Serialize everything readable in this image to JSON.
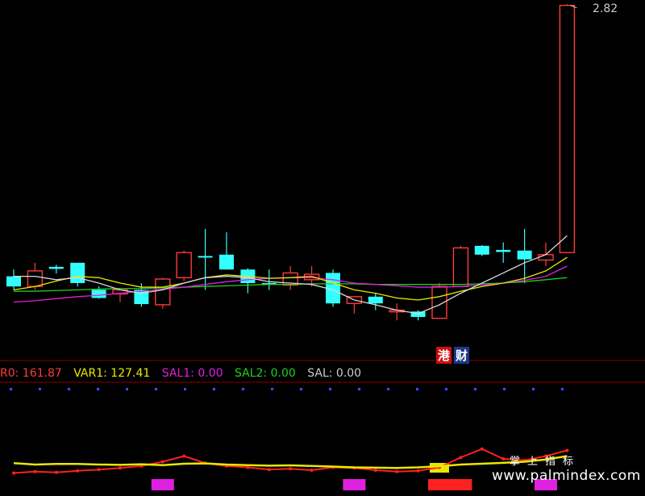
{
  "chart_data": {
    "type": "candlestick",
    "price_label": "2.82",
    "colors": {
      "up": "#ff3b3b",
      "down": "#33ffff",
      "ma1": "#d8d8d8",
      "ma2": "#e8e800",
      "ma3": "#e020e0",
      "ma4": "#20d020",
      "grid": "#8b0000",
      "dots": "#3355ff"
    },
    "candles": [
      {
        "o": 2.42,
        "h": 2.43,
        "l": 2.4,
        "c": 2.405,
        "up": false
      },
      {
        "o": 2.405,
        "h": 2.44,
        "l": 2.4,
        "c": 2.428,
        "up": true
      },
      {
        "o": 2.434,
        "h": 2.437,
        "l": 2.424,
        "c": 2.431,
        "up": false
      },
      {
        "o": 2.44,
        "h": 2.44,
        "l": 2.405,
        "c": 2.41,
        "up": false
      },
      {
        "o": 2.4,
        "h": 2.405,
        "l": 2.387,
        "c": 2.388,
        "up": false
      },
      {
        "o": 2.394,
        "h": 2.4,
        "l": 2.382,
        "c": 2.4,
        "up": true
      },
      {
        "o": 2.4,
        "h": 2.41,
        "l": 2.375,
        "c": 2.379,
        "up": false
      },
      {
        "o": 2.378,
        "h": 2.418,
        "l": 2.372,
        "c": 2.416,
        "up": true
      },
      {
        "o": 2.418,
        "h": 2.458,
        "l": 2.413,
        "c": 2.455,
        "up": true
      },
      {
        "o": 2.449,
        "h": 2.49,
        "l": 2.4,
        "c": 2.45,
        "up": false
      },
      {
        "o": 2.452,
        "h": 2.485,
        "l": 2.44,
        "c": 2.43,
        "up": false
      },
      {
        "o": 2.43,
        "h": 2.432,
        "l": 2.395,
        "c": 2.41,
        "up": false
      },
      {
        "o": 2.41,
        "h": 2.43,
        "l": 2.4,
        "c": 2.41,
        "up": false
      },
      {
        "o": 2.407,
        "h": 2.435,
        "l": 2.4,
        "c": 2.425,
        "up": true
      },
      {
        "o": 2.423,
        "h": 2.435,
        "l": 2.405,
        "c": 2.415,
        "up": true
      },
      {
        "o": 2.425,
        "h": 2.43,
        "l": 2.375,
        "c": 2.38,
        "up": false
      },
      {
        "o": 2.38,
        "h": 2.39,
        "l": 2.365,
        "c": 2.39,
        "up": true
      },
      {
        "o": 2.39,
        "h": 2.395,
        "l": 2.37,
        "c": 2.38,
        "up": false
      },
      {
        "o": 2.37,
        "h": 2.38,
        "l": 2.355,
        "c": 2.37,
        "up": true
      },
      {
        "o": 2.368,
        "h": 2.37,
        "l": 2.355,
        "c": 2.36,
        "up": false
      },
      {
        "o": 2.358,
        "h": 2.41,
        "l": 2.358,
        "c": 2.405,
        "up": true
      },
      {
        "o": 2.405,
        "h": 2.465,
        "l": 2.405,
        "c": 2.462,
        "up": true
      },
      {
        "o": 2.465,
        "h": 2.466,
        "l": 2.45,
        "c": 2.452,
        "up": false
      },
      {
        "o": 2.459,
        "h": 2.47,
        "l": 2.44,
        "c": 2.456,
        "up": false
      },
      {
        "o": 2.458,
        "h": 2.49,
        "l": 2.41,
        "c": 2.445,
        "up": false
      },
      {
        "o": 2.444,
        "h": 2.47,
        "l": 2.435,
        "c": 2.452,
        "up": true
      },
      {
        "o": 2.455,
        "h": 2.822,
        "l": 2.455,
        "c": 2.82,
        "up": true
      }
    ],
    "ma1": [
      2.42,
      2.42,
      2.415,
      2.418,
      2.41,
      2.4,
      2.395,
      2.4,
      2.41,
      2.418,
      2.42,
      2.418,
      2.412,
      2.41,
      2.408,
      2.4,
      2.385,
      2.378,
      2.37,
      2.365,
      2.378,
      2.395,
      2.41,
      2.425,
      2.44,
      2.452,
      2.48
    ],
    "ma2": [
      2.4,
      2.405,
      2.413,
      2.42,
      2.418,
      2.41,
      2.404,
      2.404,
      2.41,
      2.418,
      2.422,
      2.42,
      2.417,
      2.418,
      2.42,
      2.41,
      2.4,
      2.395,
      2.388,
      2.385,
      2.39,
      2.398,
      2.405,
      2.41,
      2.417,
      2.428,
      2.448
    ],
    "ma3": [
      2.382,
      2.384,
      2.387,
      2.39,
      2.392,
      2.395,
      2.398,
      2.401,
      2.404,
      2.408,
      2.412,
      2.415,
      2.417,
      2.418,
      2.418,
      2.415,
      2.41,
      2.408,
      2.406,
      2.404,
      2.404,
      2.405,
      2.407,
      2.41,
      2.414,
      2.42,
      2.435
    ],
    "ma4": [
      2.398,
      2.398,
      2.399,
      2.4,
      2.401,
      2.402,
      2.402,
      2.403,
      2.404,
      2.405,
      2.406,
      2.407,
      2.408,
      2.408,
      2.409,
      2.409,
      2.409,
      2.408,
      2.408,
      2.408,
      2.408,
      2.408,
      2.409,
      2.41,
      2.412,
      2.415,
      2.418
    ],
    "legend": [
      {
        "label": "R0: 161.87",
        "color": "#ff3b3b"
      },
      {
        "label": "VAR1: 127.41",
        "color": "#e8e800"
      },
      {
        "label": "SAL1: 0.00",
        "color": "#e020e0"
      },
      {
        "label": "SAL2: 0.00",
        "color": "#20d020"
      },
      {
        "label": "SAL: 0.00",
        "color": "#cccccc"
      }
    ],
    "indicator": {
      "yellow": [
        0.45,
        0.4,
        0.42,
        0.42,
        0.4,
        0.39,
        0.41,
        0.38,
        0.43,
        0.44,
        0.4,
        0.38,
        0.36,
        0.37,
        0.35,
        0.33,
        0.3,
        0.29,
        0.28,
        0.3,
        0.34,
        0.4,
        0.43,
        0.46,
        0.5,
        0.58,
        0.7
      ],
      "red": [
        0.1,
        0.15,
        0.12,
        0.18,
        0.22,
        0.28,
        0.35,
        0.5,
        0.7,
        0.45,
        0.35,
        0.3,
        0.22,
        0.25,
        0.2,
        0.3,
        0.28,
        0.2,
        0.15,
        0.18,
        0.3,
        0.65,
        0.95,
        0.6,
        0.55,
        0.7,
        0.9
      ],
      "bars": [
        {
          "i": 7,
          "color": "#e020e0"
        },
        {
          "i": 16,
          "color": "#e020e0"
        },
        {
          "i": 20,
          "color": "#ff2020"
        },
        {
          "i": 21,
          "color": "#ff2020"
        },
        {
          "i": 25,
          "color": "#e020e0"
        }
      ],
      "signal_index": 20
    }
  },
  "badges": [
    {
      "text": "港",
      "bg": "#cc1010",
      "fg": "#ffffff"
    },
    {
      "text": "财",
      "bg": "#1a3a8a",
      "fg": "#ffffff"
    }
  ],
  "watermark": {
    "line1": "掌上指标",
    "line2": "www.palmindex.com"
  }
}
